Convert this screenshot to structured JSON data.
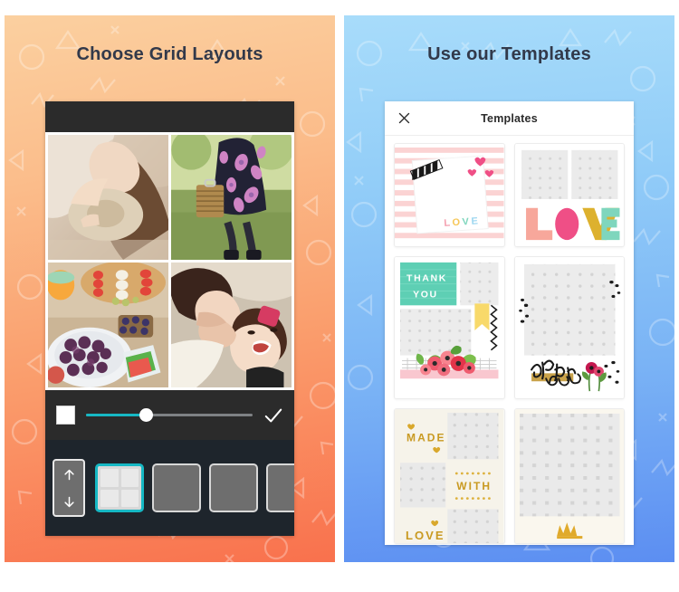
{
  "panels": [
    {
      "id": "grid-layouts",
      "title": "Choose Grid Layouts",
      "accent": "#f9854f",
      "gradient_from": "#fbd0a0",
      "gradient_to": "#f9714d",
      "editor": {
        "photos": [
          {
            "name": "woman-with-straw-hat-on-blanket"
          },
          {
            "name": "woman-in-floral-dress-with-picnic-basket"
          },
          {
            "name": "picnic-food-platter-with-fruit"
          },
          {
            "name": "two-women-laughing-on-blanket"
          }
        ],
        "toolbar": {
          "color_swatch_label": "White",
          "color_swatch_hex": "#ffffff",
          "slider_name": "border-size-slider",
          "slider_value": 36,
          "slider_fill_hex": "#16b8c4",
          "confirm_label": "Done"
        },
        "layout_picker": {
          "scroll_up_label": "Scroll up",
          "scroll_down_label": "Scroll down",
          "selected_index": 0,
          "selected_hex": "#16b8c4",
          "thumbs": [
            {
              "name": "layout-2x2",
              "selected": true
            },
            {
              "name": "layout-left-plus-three-right",
              "selected": false
            },
            {
              "name": "layout-top-plus-three-bottom",
              "selected": false
            },
            {
              "name": "layout-partial",
              "selected": false
            }
          ]
        }
      }
    },
    {
      "id": "templates",
      "title": "Use our Templates",
      "accent": "#5c8ef2",
      "gradient_from": "#a8dcfa",
      "gradient_to": "#5c8ef2",
      "sheet": {
        "header_title": "Templates",
        "close_label": "Close",
        "templates": [
          {
            "name": "pink-stripes-love-card",
            "caption": "LOVE",
            "style": "pink-stripes"
          },
          {
            "name": "love-block-letters",
            "caption": "LOVE",
            "style": "block-letters"
          },
          {
            "name": "thank-you-mint-floral",
            "caption": "THANK YOU",
            "style": "mint-floral"
          },
          {
            "name": "thank-you-script-poppies",
            "caption": "Thank you",
            "style": "script-poppies"
          },
          {
            "name": "made-with-love-gold",
            "caption": "MADE WITH LOVE",
            "style": "gold-type"
          },
          {
            "name": "gold-crown-dots",
            "caption": "",
            "style": "gold-crown"
          }
        ]
      }
    }
  ]
}
